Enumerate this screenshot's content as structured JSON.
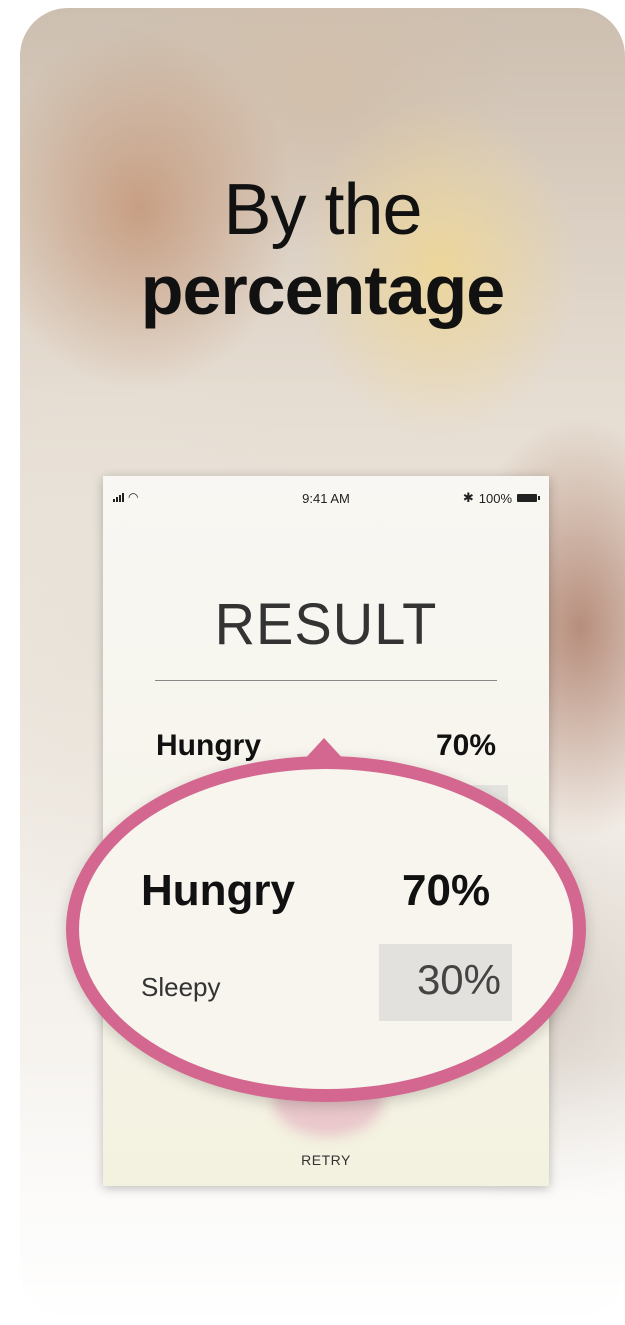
{
  "headline": {
    "line1": "By the",
    "line2": "percentage"
  },
  "status_bar": {
    "time": "9:41 AM",
    "battery": "100%",
    "icons": [
      "signal-icon",
      "wifi-icon",
      "bluetooth-icon",
      "battery-icon"
    ]
  },
  "result": {
    "title": "RESULT",
    "rows": [
      {
        "label": "Hungry",
        "value": "70%"
      },
      {
        "label": "Sleepy",
        "value": "30%"
      }
    ],
    "retry_label": "RETRY"
  },
  "colors": {
    "accent": "#d3678f",
    "text_dark": "#111111",
    "highlight_box": "#e2e1dd"
  }
}
